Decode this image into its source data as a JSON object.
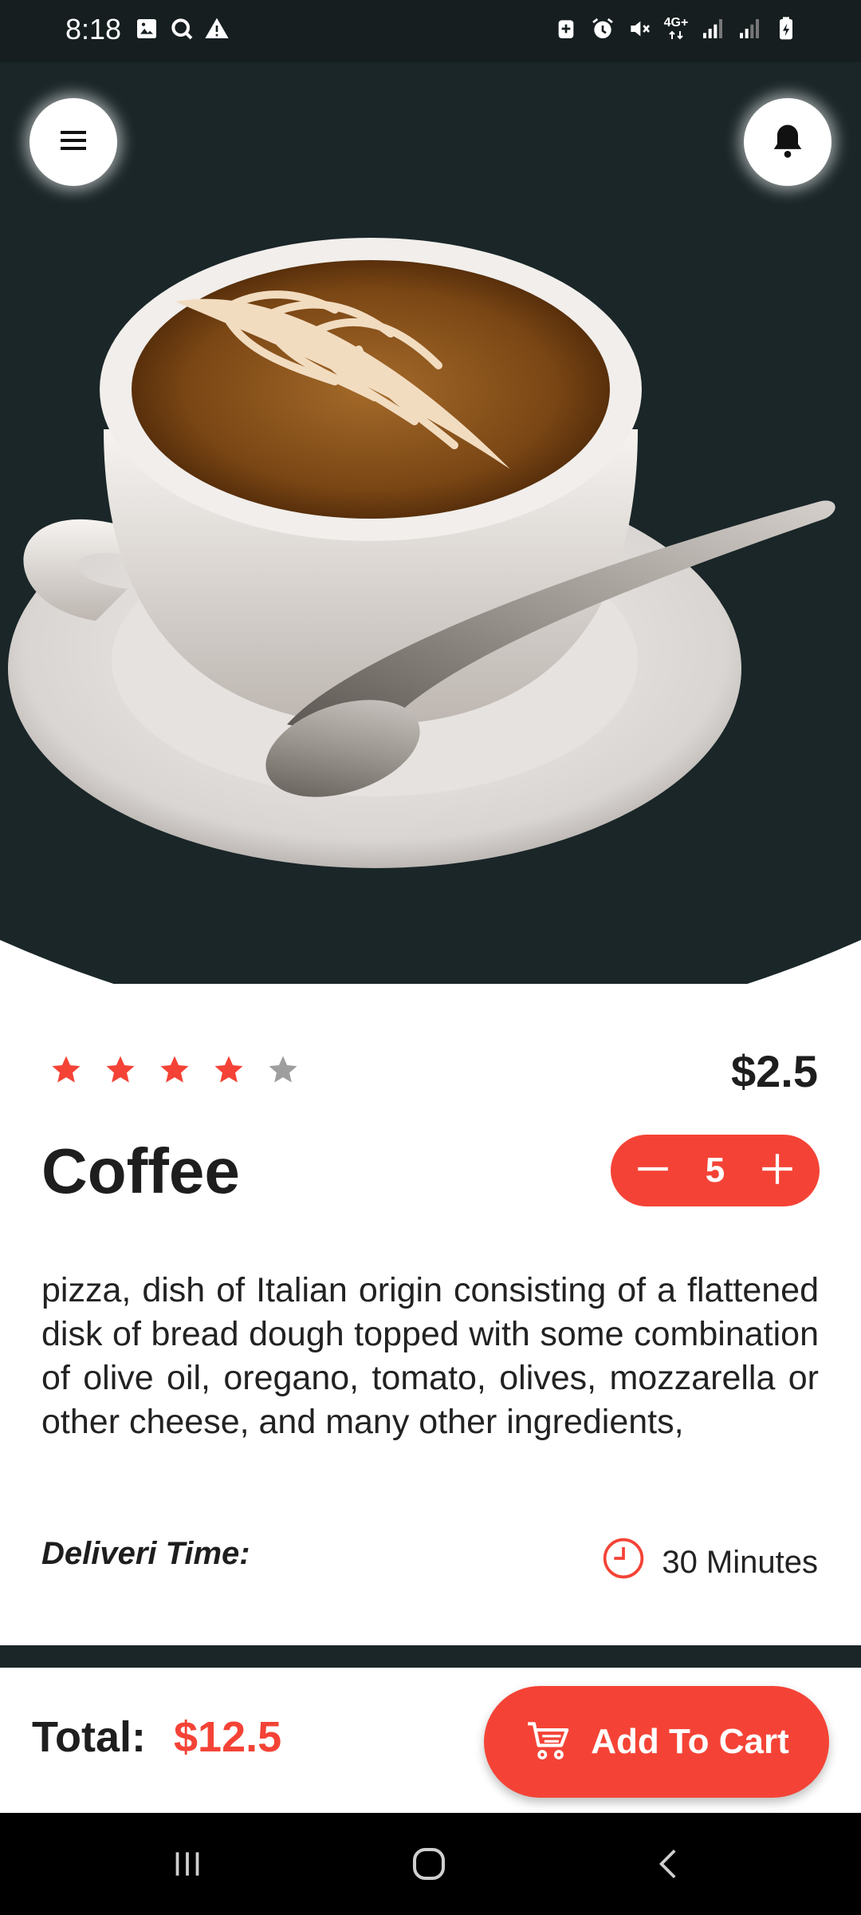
{
  "status_bar": {
    "time": "8:18",
    "left_icons": [
      "image-icon",
      "search-circle-icon",
      "warning-icon"
    ],
    "right_icons": [
      "battery-saver-icon",
      "alarm-icon",
      "mute-icon",
      "network-4g-icon",
      "signal-icon",
      "signal-icon",
      "battery-icon"
    ],
    "network_label": "4G+"
  },
  "header": {
    "menu_icon": "hamburger-menu-icon",
    "notification_icon": "bell-icon"
  },
  "product": {
    "image": "coffee-cup-latte-art",
    "rating": 4,
    "rating_max": 5,
    "price": "$2.5",
    "name": "Coffee",
    "quantity": "5",
    "description": "pizza, dish of Italian origin consisting of a flattened disk of bread dough topped with some combination of olive oil, oregano, tomato, olives, mozzarella or other cheese, and many other ingredients,",
    "delivery_label": "Deliveri Time:",
    "delivery_value": "30 Minutes"
  },
  "footer": {
    "total_label": "Total:",
    "total_value": "$12.5",
    "add_to_cart_label": "Add To Cart"
  },
  "colors": {
    "accent": "#f44336",
    "hero_bg": "#1a2628",
    "star_empty": "#9e9e9e",
    "text": "#1e1e1e"
  }
}
